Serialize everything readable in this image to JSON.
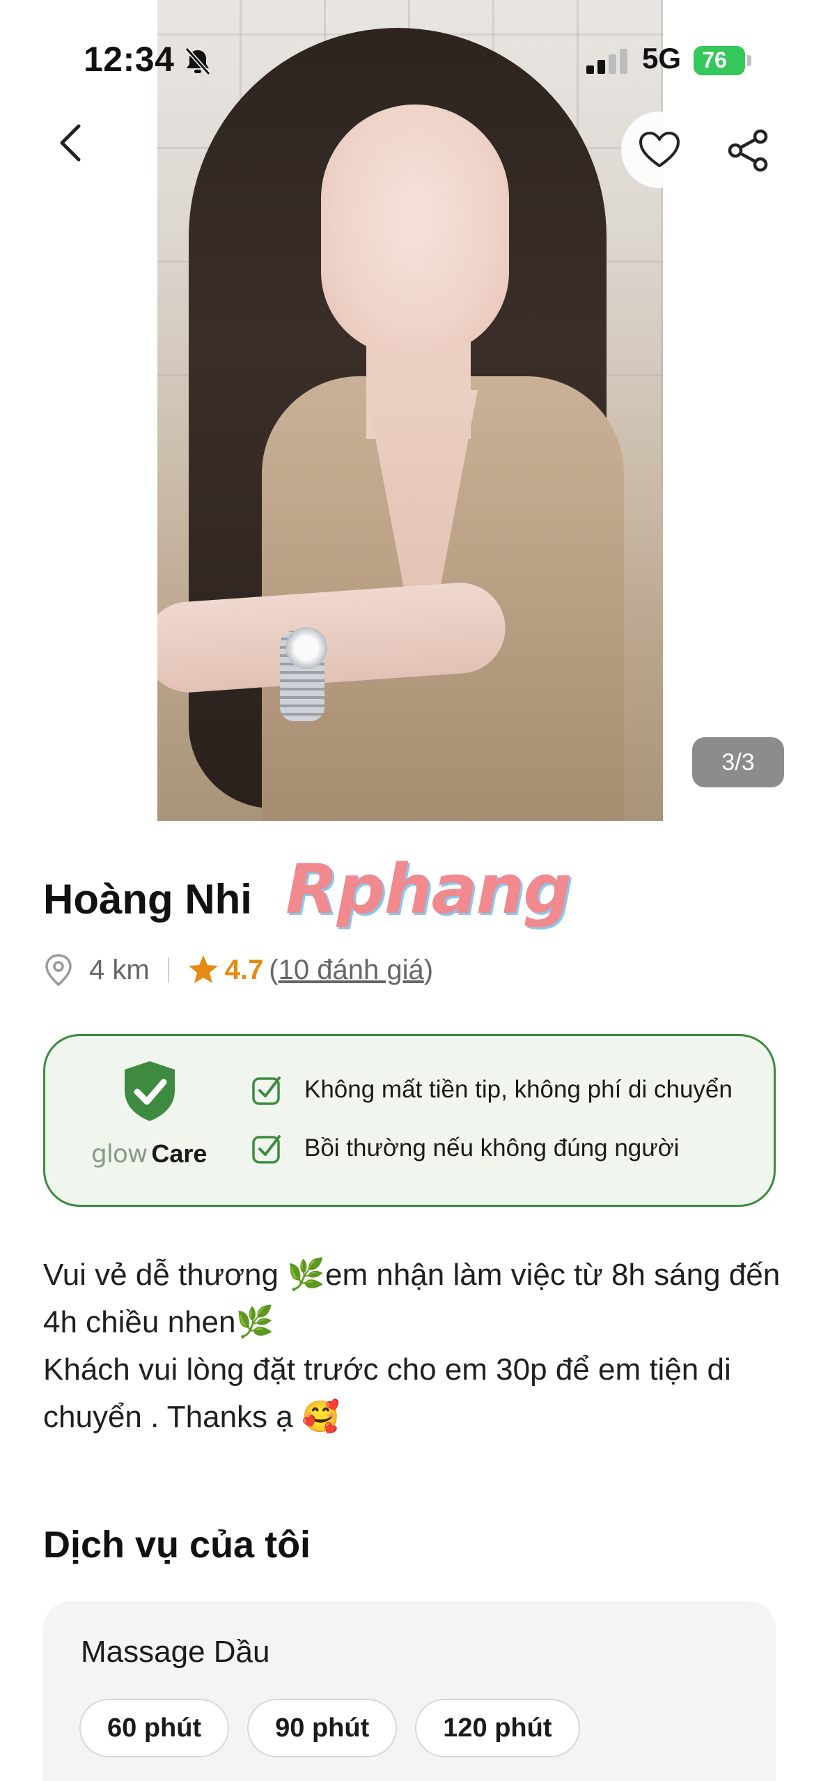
{
  "status_bar": {
    "time": "12:34",
    "network": "5G",
    "battery": "76"
  },
  "gallery": {
    "counter": "3/3"
  },
  "profile": {
    "name": "Hoàng Nhi",
    "watermark": "Rphang",
    "distance": "4 km",
    "rating": "4.7",
    "reviews_open": "(",
    "reviews": "10 đánh giá",
    "reviews_close": ")"
  },
  "care": {
    "brand_glow": "glow",
    "brand_care": "Care",
    "items": [
      "Không mất tiền tip, không phí di chuyển",
      "Bồi thường nếu không đúng người"
    ]
  },
  "description": {
    "lines": [
      "Vui vẻ dễ thương 🌿em nhận làm việc từ 8h sáng đến 4h chiều nhen🌿",
      "Khách vui lòng đặt trước cho em 30p để em tiện di chuyển . Thanks ạ 🥰"
    ]
  },
  "services": {
    "title": "Dịch vụ của tôi",
    "items": [
      {
        "name": "Massage Dầu",
        "durations": [
          "60 phút",
          "90 phút",
          "120 phút"
        ]
      }
    ]
  },
  "colors": {
    "accent_green": "#3e8a40",
    "rating_orange": "#e58a12",
    "battery_green": "#34c759"
  },
  "icons": [
    "bell-off-icon",
    "signal-icon",
    "battery-icon",
    "back-chevron-icon",
    "heart-icon",
    "share-icon",
    "location-pin-icon",
    "star-icon",
    "shield-check-icon",
    "checkbox-icon"
  ]
}
